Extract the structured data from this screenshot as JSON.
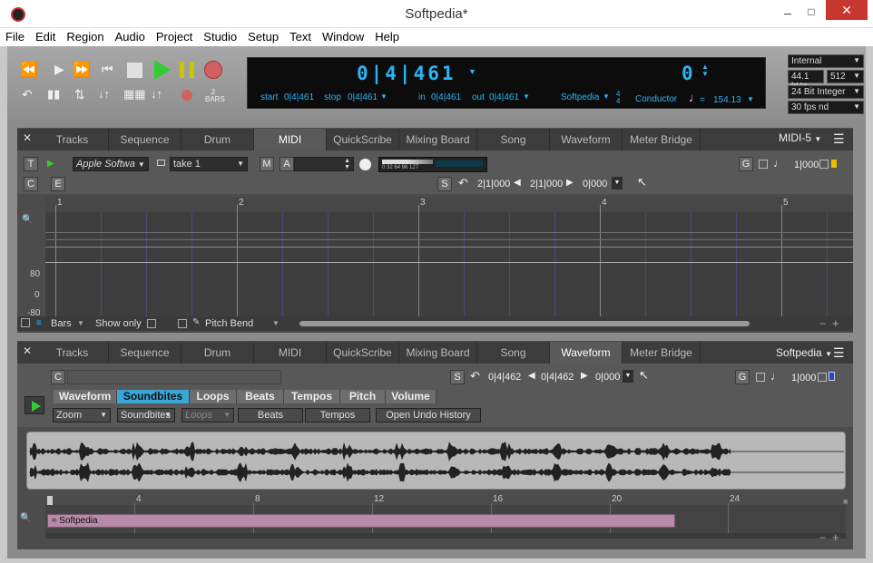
{
  "window": {
    "title": "Softpedia*"
  },
  "menu": [
    "File",
    "Edit",
    "Region",
    "Audio",
    "Project",
    "Studio",
    "Setup",
    "Text",
    "Window",
    "Help"
  ],
  "transport": {
    "main_counter": "0|4|461",
    "secondary_counter": "0",
    "start_label": "start",
    "start_value": "0|4|461",
    "stop_label": "stop",
    "stop_value": "0|4|461",
    "in_label": "in",
    "in_value": "0|4|461",
    "out_label": "out",
    "out_value": "0|4|461",
    "project_name": "Softpedia",
    "time_sig_top": "4",
    "time_sig_bottom": "4",
    "conductor_label": "Conductor",
    "tempo": "154.13",
    "bars_label": "2\nBARS",
    "sync": "Internal",
    "sample_rate": "44.1 kHz",
    "buffer": "512",
    "bit_depth": "24 Bit Integer",
    "frame_rate": "30 fps nd"
  },
  "top_panel": {
    "tabs": [
      "Tracks",
      "Sequence",
      "Drum",
      "MIDI",
      "QuickScribe",
      "Mixing Board",
      "Song",
      "Waveform",
      "Meter Bridge"
    ],
    "active_tab": "MIDI",
    "window_name": "MIDI-5",
    "track_label": "T",
    "input": "Apple Softwa",
    "take": "take 1",
    "m_label": "M",
    "a_label": "A",
    "meter_scale": "0 32 64 96 127",
    "g_label": "G",
    "g_value": "1|000",
    "c_label": "C",
    "e_label": "E",
    "s_label": "S",
    "s_value1": "2|1|000",
    "s_value2": "2|1|000",
    "s_value3": "0|000",
    "ruler": [
      "1",
      "2",
      "3",
      "4",
      "5"
    ],
    "velocity_labels": [
      "80",
      "0",
      "-80"
    ],
    "bottom": {
      "bars": "Bars",
      "show_only": "Show only",
      "pitch_bend": "Pitch Bend"
    }
  },
  "bottom_panel": {
    "tabs": [
      "Tracks",
      "Sequence",
      "Drum",
      "MIDI",
      "QuickScribe",
      "Mixing Board",
      "Song",
      "Waveform",
      "Meter Bridge"
    ],
    "active_tab": "Waveform",
    "window_name": "Softpedia",
    "c_label": "C",
    "s_label": "S",
    "s_value1": "0|4|462",
    "s_value2": "0|4|462",
    "s_value3": "0|000",
    "g_label": "G",
    "g_value": "1|000",
    "subtabs": [
      "Waveform",
      "Soundbites",
      "Loops",
      "Beats",
      "Tempos",
      "Pitch",
      "Volume"
    ],
    "active_subtab": "Soundbites",
    "zoom": "Zoom",
    "soundbites_menu": "Soundbites",
    "loops": "Loops",
    "beats": "Beats",
    "tempos": "Tempos",
    "undo_history": "Open Undo History",
    "ruler": [
      "4",
      "8",
      "12",
      "16",
      "20",
      "24"
    ],
    "region_name": "Softpedia"
  },
  "colors": {
    "accent": "#29b6f6",
    "play": "#2ecc40",
    "record": "#d9534f",
    "region": "#b88aa8"
  }
}
